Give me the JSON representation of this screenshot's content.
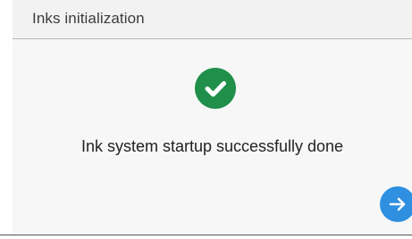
{
  "header": {
    "title": "Inks initialization"
  },
  "main": {
    "status_icon": "check-circle-icon",
    "message": "Ink system startup successfully done"
  },
  "actions": {
    "next_icon": "arrow-right-icon"
  },
  "colors": {
    "success": "#1f8f4a",
    "accent": "#2f8fe0",
    "header_bg": "#f2f2f2",
    "content_bg": "#f7f7f7"
  }
}
